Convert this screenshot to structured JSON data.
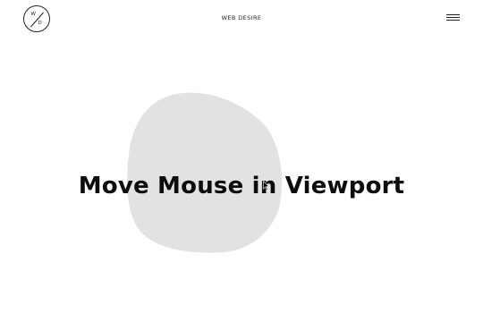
{
  "header": {
    "logo_letter_top": "W",
    "logo_letter_bottom": "D",
    "brand": "WEB DESIRE",
    "menu_icon": "hamburger-menu-icon"
  },
  "hero": {
    "headline": "Move Mouse in Viewport",
    "blob_color": "#e2e2e2"
  },
  "cursor": {
    "icon": "mouse-pointer-icon"
  }
}
